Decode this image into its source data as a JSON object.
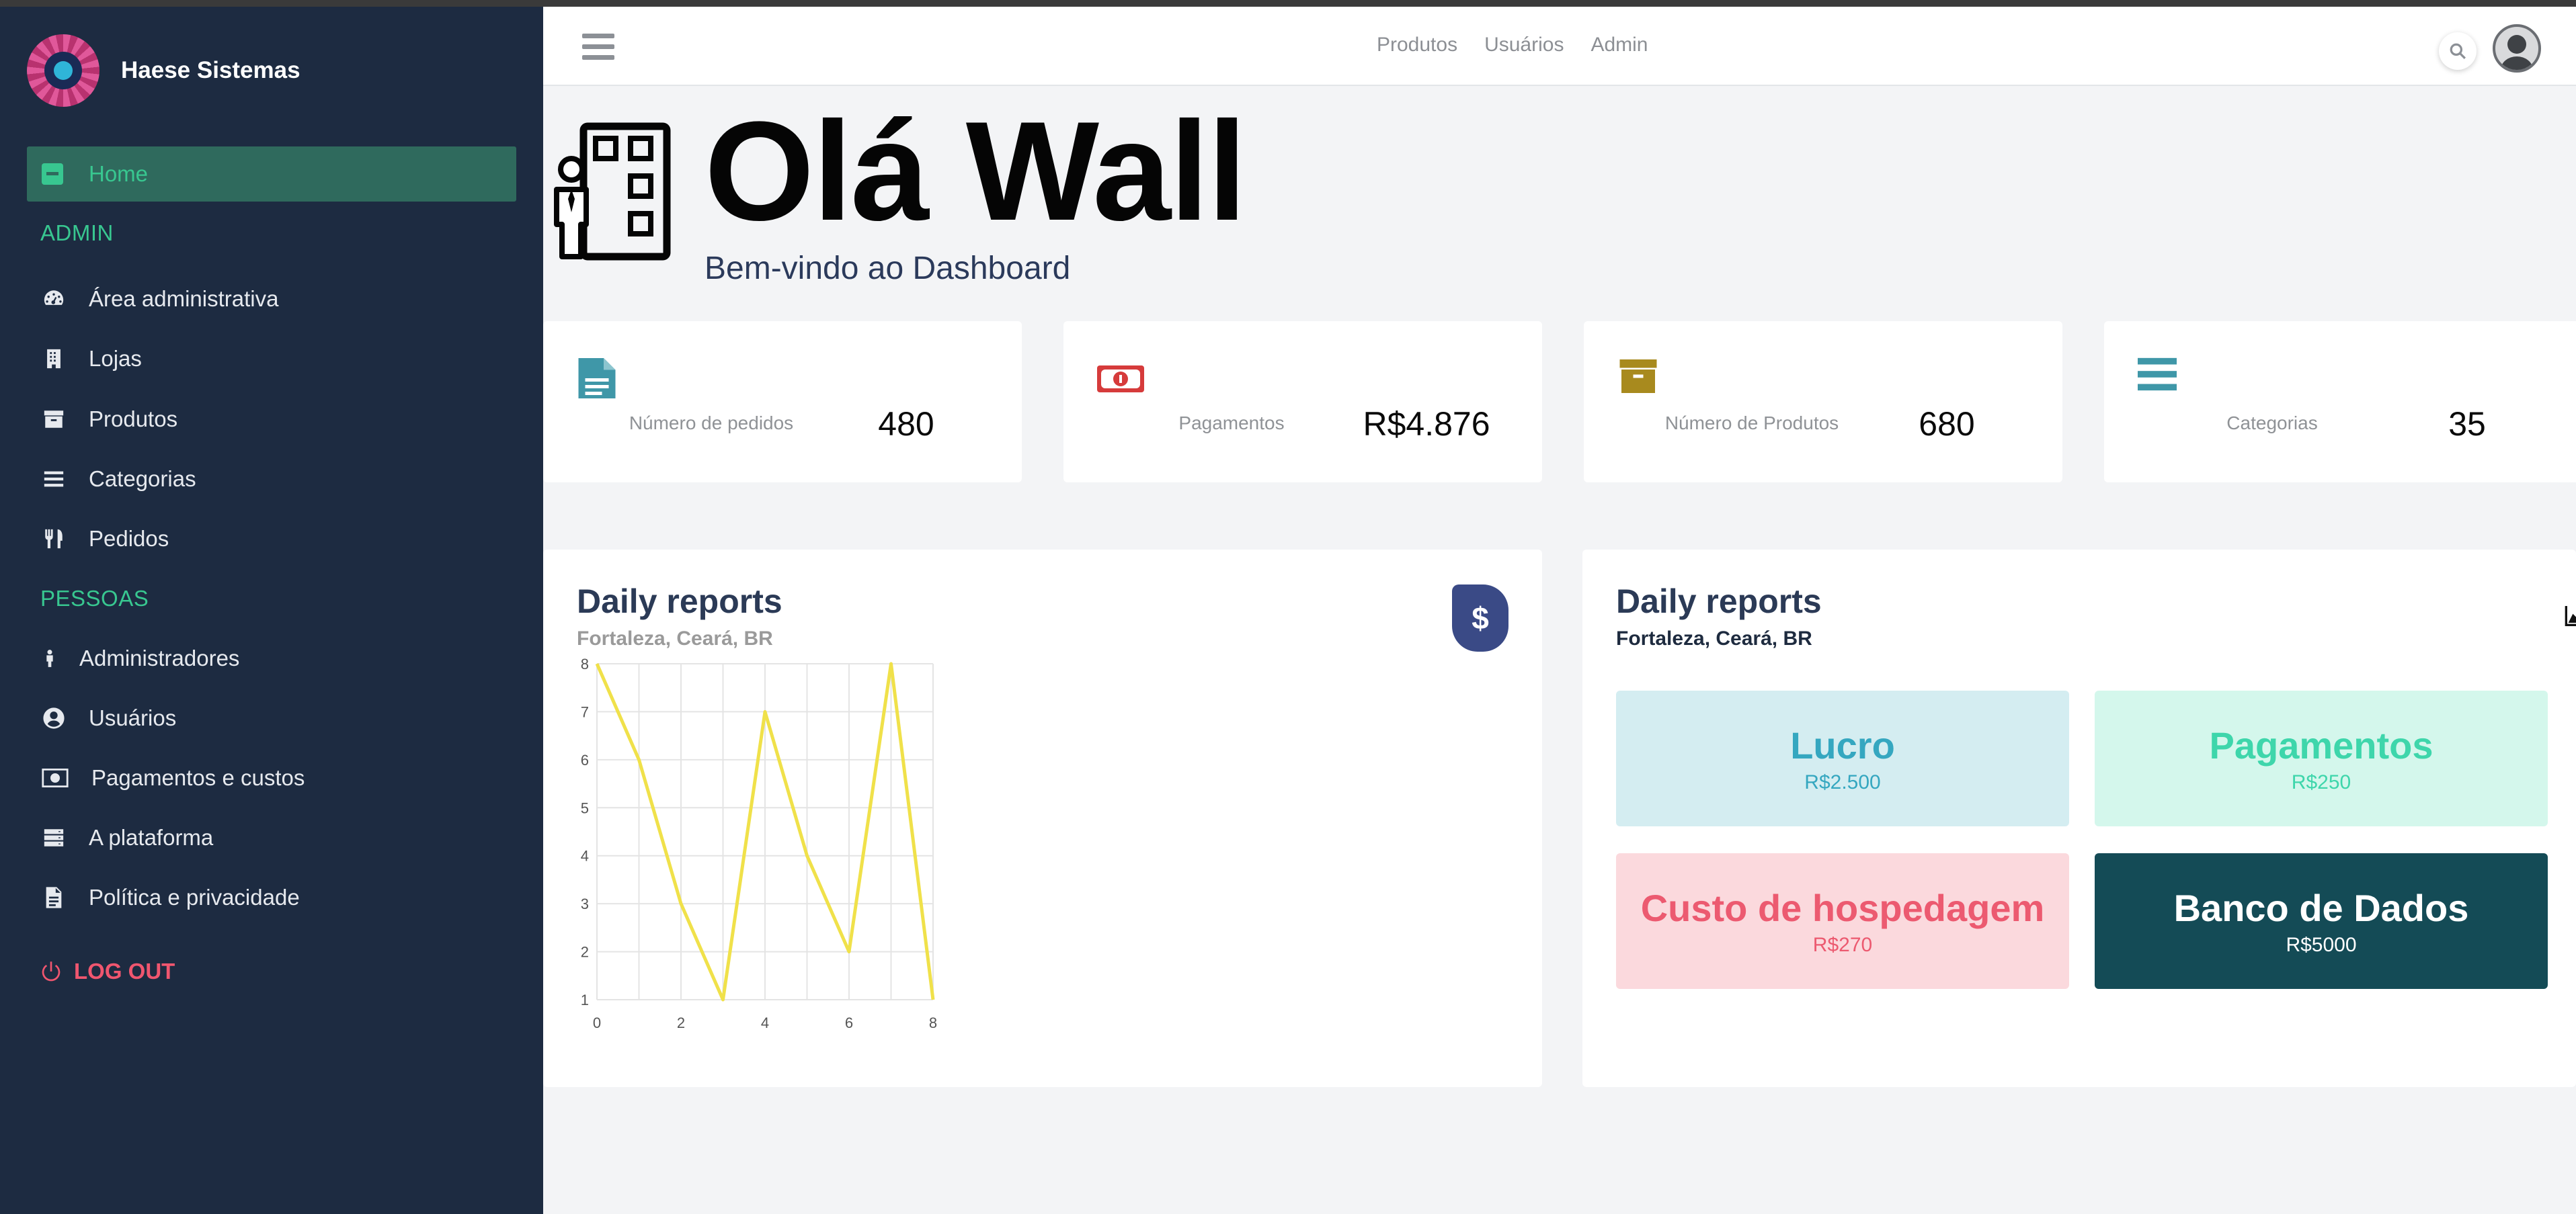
{
  "brand": {
    "name": "Haese Sistemas"
  },
  "sidebar": {
    "home": "Home",
    "sections": [
      "ADMIN",
      "PESSOAS"
    ],
    "items": [
      {
        "label": "Área administrativa",
        "icon": "dashboard-icon"
      },
      {
        "label": "Lojas",
        "icon": "building-icon"
      },
      {
        "label": "Produtos",
        "icon": "archive-icon"
      },
      {
        "label": "Categorias",
        "icon": "list-icon"
      },
      {
        "label": "Pedidos",
        "icon": "utensils-icon"
      },
      {
        "label": "Administradores",
        "icon": "person-icon"
      },
      {
        "label": "Usuários",
        "icon": "user-circle-icon"
      },
      {
        "label": "Pagamentos e custos",
        "icon": "money-icon"
      },
      {
        "label": "A plataforma",
        "icon": "server-icon"
      },
      {
        "label": "Política e privacidade",
        "icon": "document-icon"
      }
    ],
    "logout": "LOG OUT"
  },
  "header": {
    "nav": [
      "Produtos",
      "Usuários",
      "Admin"
    ]
  },
  "hero": {
    "title": "Olá Wall",
    "subtitle": "Bem-vindo ao Dashboard"
  },
  "stats": [
    {
      "label": "Número de pedidos",
      "value": "480",
      "icon": "file-icon",
      "color": "#3f97a8"
    },
    {
      "label": "Pagamentos",
      "value": "R$4.876",
      "icon": "money-icon",
      "color": "#d63b3b"
    },
    {
      "label": "Número de Produtos",
      "value": "680",
      "icon": "archive-icon",
      "color": "#a88a1e"
    },
    {
      "label": "Categorias",
      "value": "35",
      "icon": "list-icon",
      "color": "#3f97a8"
    }
  ],
  "reports": {
    "left": {
      "title": "Daily reports",
      "subtitle": "Fortaleza, Ceará, BR",
      "badge": "$"
    },
    "right": {
      "title": "Daily reports",
      "subtitle": "Fortaleza, Ceará, BR"
    }
  },
  "tiles": [
    {
      "title": "Lucro",
      "value": "R$2.500",
      "bg": "#d4edf1",
      "fg": "#35a7c0"
    },
    {
      "title": "Pagamentos",
      "value": "R$250",
      "bg": "#d4f7ec",
      "fg": "#3ed6ab"
    },
    {
      "title": "Custo de hospedagem",
      "value": "R$270",
      "bg": "#fbd9dd",
      "fg": "#ec5a70"
    },
    {
      "title": "Banco de Dados",
      "value": "R$5000",
      "bg": "#144b56",
      "fg": "#ffffff"
    }
  ],
  "chart_data": {
    "type": "line",
    "x": [
      0,
      1,
      2,
      3,
      4,
      5,
      6,
      7,
      8
    ],
    "series": [
      {
        "values": [
          8,
          6,
          3,
          1,
          7,
          4,
          2,
          8,
          1
        ],
        "color": "#f0e14a"
      }
    ],
    "xticks": [
      "0",
      "2",
      "4",
      "6",
      "8"
    ],
    "yticks": [
      "1",
      "2",
      "3",
      "4",
      "5",
      "6",
      "7",
      "8"
    ],
    "xlim": [
      0,
      8
    ],
    "ylim": [
      1,
      8
    ],
    "grid": true
  }
}
